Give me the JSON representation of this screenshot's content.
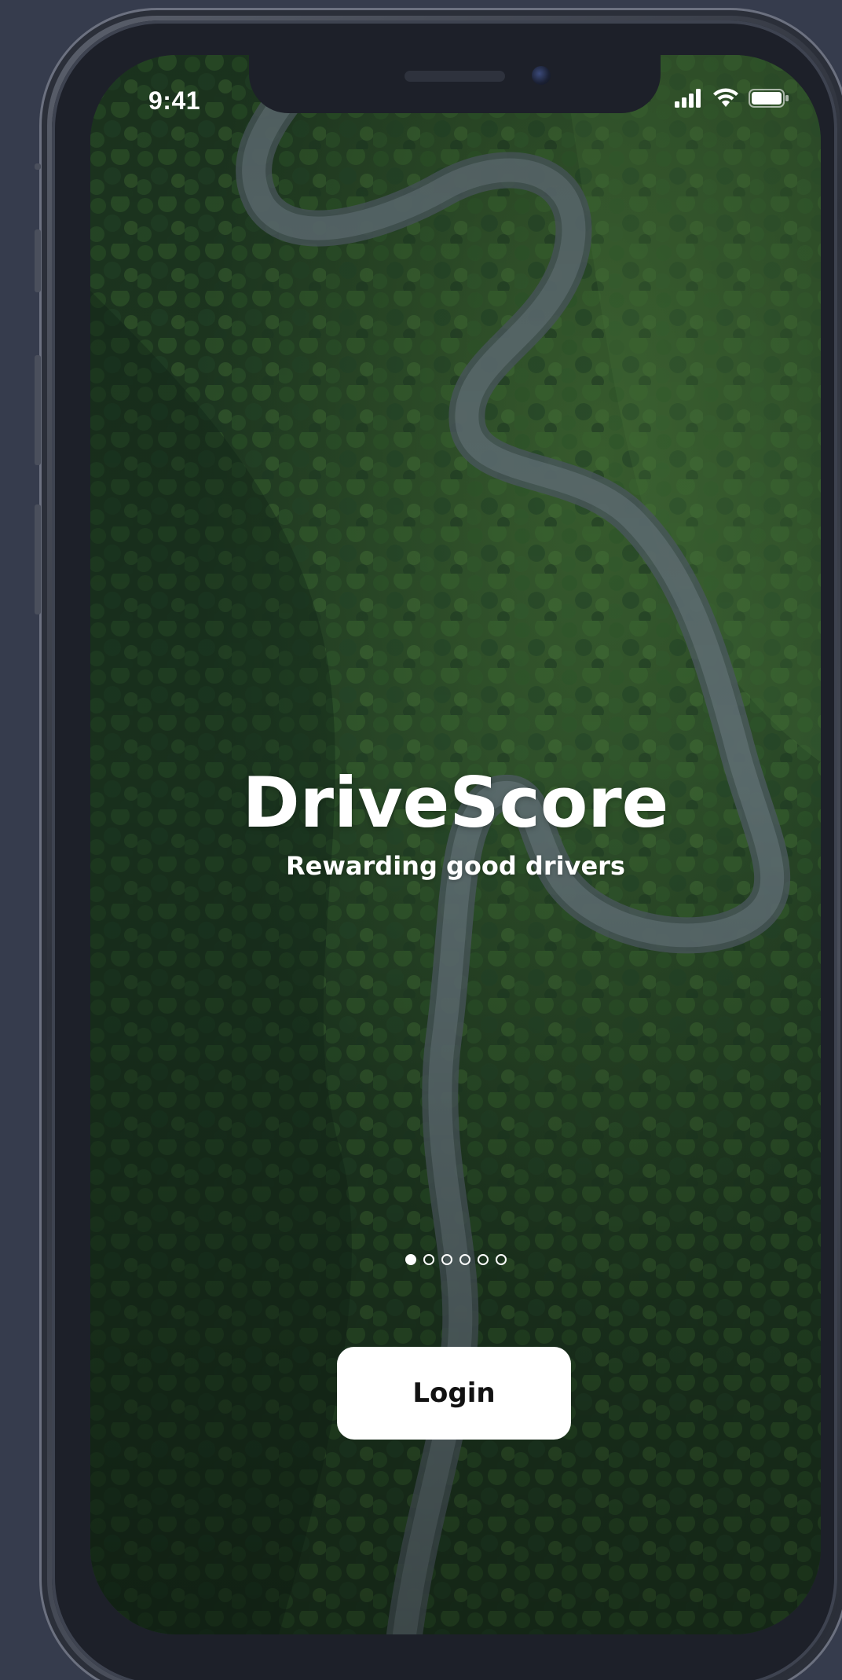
{
  "status_bar": {
    "time": "9:41",
    "signal_icon": "cellular-signal-icon",
    "wifi_icon": "wifi-icon",
    "battery_icon": "battery-icon"
  },
  "app": {
    "name": "DriveScore",
    "tagline": "Rewarding good drivers"
  },
  "background": {
    "description_icon": "aerial-forest-road-image"
  },
  "pagination": {
    "total": 6,
    "active_index": 0
  },
  "actions": {
    "login_label": "Login"
  },
  "colors": {
    "page_background": "#363c4d",
    "button_background": "#ffffff",
    "button_text": "#121212",
    "text_primary": "#ffffff"
  }
}
